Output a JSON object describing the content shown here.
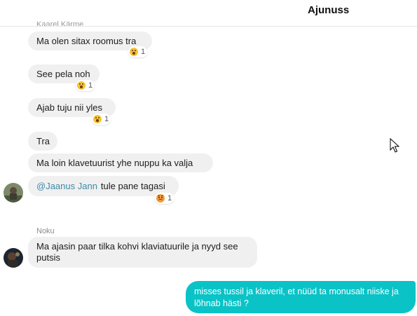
{
  "header": {
    "title": "Ajunuss"
  },
  "top_cut_name": "Kaarel Kärme",
  "messages": [
    {
      "text": "Ma olen sitax roomus tra",
      "reaction": {
        "icon": "surprised-face-icon",
        "count": "1"
      }
    },
    {
      "text": "See pela noh",
      "reaction": {
        "icon": "surprised-face-icon",
        "count": "1"
      }
    },
    {
      "text": "Ajab tuju nii yles",
      "reaction": {
        "icon": "surprised-face-icon",
        "count": "1"
      }
    },
    {
      "text": "Tra"
    },
    {
      "text": "Ma loin klavetuurist yhe nuppu ka valja"
    },
    {
      "mention": "@Jaanus Jann",
      "text": "tule pane tagasi",
      "reaction": {
        "icon": "angry-face-icon",
        "count": "1"
      }
    }
  ],
  "second_sender": {
    "name": "Noku",
    "text": "Ma ajasin paar tilka kohvi klaviatuurile ja nyyd see putsis"
  },
  "outgoing": {
    "text": "misses tussil ja klaveril, et nüüd ta monusalt niiske ja lõhnab hästi ?"
  },
  "colors": {
    "incoming_bubble": "#f1f0f0",
    "outgoing_bubble": "#09c3c7",
    "mention": "#3a8ca8"
  }
}
